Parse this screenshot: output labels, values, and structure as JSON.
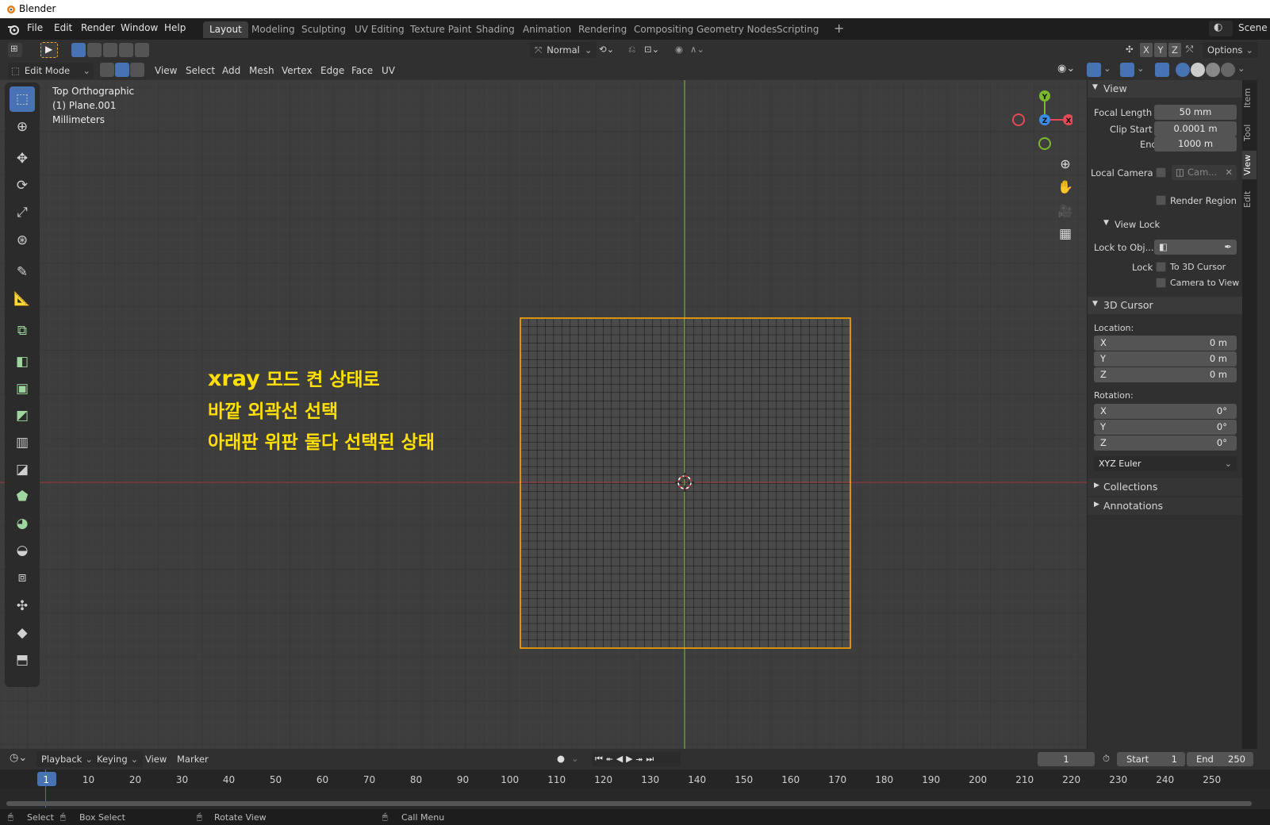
{
  "window": {
    "title": "Blender"
  },
  "menu": {
    "file": "File",
    "edit": "Edit",
    "render": "Render",
    "window": "Window",
    "help": "Help"
  },
  "workspaces": [
    "Layout",
    "Modeling",
    "Sculpting",
    "UV Editing",
    "Texture Paint",
    "Shading",
    "Animation",
    "Rendering",
    "Compositing",
    "Geometry Nodes",
    "Scripting"
  ],
  "scene": "Scene",
  "header1": {
    "transform_orientation": "Normal",
    "options": "Options",
    "axes": [
      "X",
      "Y",
      "Z"
    ]
  },
  "header2": {
    "mode": "Edit Mode",
    "menus": [
      "View",
      "Select",
      "Add",
      "Mesh",
      "Vertex",
      "Edge",
      "Face",
      "UV"
    ]
  },
  "viewport": {
    "view_name": "Top Orthographic",
    "object": "(1) Plane.001",
    "units": "Millimeters",
    "annotation_line1_bold": "xray",
    "annotation_line1_rest": " 모드 켠 상태로",
    "annotation_line2": "바깥 외곽선 선택",
    "annotation_line3": "아래판 위판 둘다 선택된 상태",
    "gizmo": {
      "y": "Y",
      "x": "X",
      "z": "Z"
    }
  },
  "npanel": {
    "view_header": "View",
    "focal_length_label": "Focal Length",
    "focal_length": "50 mm",
    "clip_start_label": "Clip Start",
    "clip_start": "0.0001 m",
    "clip_end_label": "End",
    "clip_end": "1000 m",
    "local_camera_label": "Local Camera",
    "local_camera_value": "Cam...",
    "render_region": "Render Region",
    "view_lock_header": "View Lock",
    "lock_to_obj_label": "Lock to Obj...",
    "lock_label": "Lock",
    "to_3d_cursor": "To 3D Cursor",
    "camera_to_view": "Camera to View",
    "cursor_header": "3D Cursor",
    "location_label": "Location:",
    "loc": [
      {
        "axis": "X",
        "value": "0 m"
      },
      {
        "axis": "Y",
        "value": "0 m"
      },
      {
        "axis": "Z",
        "value": "0 m"
      }
    ],
    "rotation_label": "Rotation:",
    "rot": [
      {
        "axis": "X",
        "value": "0°"
      },
      {
        "axis": "Y",
        "value": "0°"
      },
      {
        "axis": "Z",
        "value": "0°"
      }
    ],
    "rotation_mode": "XYZ Euler",
    "collections": "Collections",
    "annotations": "Annotations",
    "tabs": [
      "Item",
      "Tool",
      "View",
      "Edit"
    ]
  },
  "timeline": {
    "playback": "Playback",
    "keying": "Keying",
    "view": "View",
    "marker": "Marker",
    "current_frame": "1",
    "start_label": "Start",
    "start": "1",
    "end_label": "End",
    "end": "250",
    "ticks": [
      "1",
      "10",
      "20",
      "30",
      "40",
      "50",
      "60",
      "70",
      "80",
      "90",
      "100",
      "110",
      "120",
      "130",
      "140",
      "150",
      "160",
      "170",
      "180",
      "190",
      "200",
      "210",
      "220",
      "230",
      "240",
      "250"
    ]
  },
  "status": {
    "select": "Select",
    "box_select": "Box Select",
    "rotate_view": "Rotate View",
    "call_menu": "Call Menu"
  },
  "colors": {
    "accent": "#4772b3",
    "selection": "#ffa500",
    "x_axis": "#e34a55",
    "y_axis": "#7ab92b",
    "z_axis": "#3b8ce6",
    "annotation": "#ffe000"
  }
}
